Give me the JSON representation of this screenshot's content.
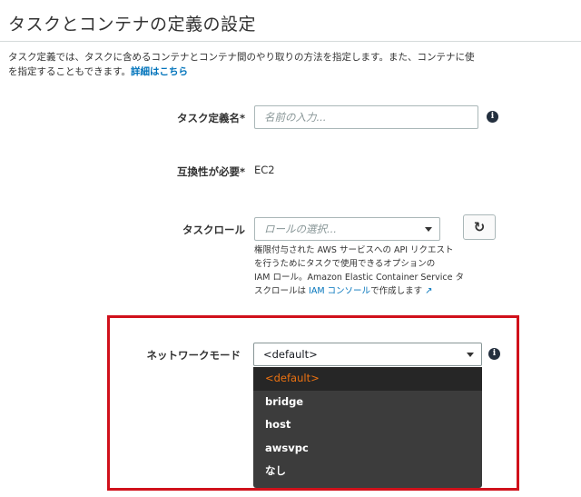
{
  "header": {
    "title": "タスクとコンテナの定義の設定"
  },
  "intro": {
    "line1": "タスク定義では、タスクに含めるコンテナとコンテナ間のやり取りの方法を指定します。また、コンテナに使",
    "line2_prefix": "を指定することもできます。",
    "link": "詳細はこちら"
  },
  "form": {
    "task_name": {
      "label": "タスク定義名",
      "required_mark": "*",
      "placeholder": "名前の入力..."
    },
    "compat": {
      "label": "互換性が必要",
      "required_mark": "*",
      "value": "EC2"
    },
    "task_role": {
      "label": "タスクロール",
      "placeholder": "ロールの選択...",
      "refresh_icon": "refresh-icon",
      "help": {
        "line1": "権限付与された AWS サービスへの API リクエスト",
        "line2": "を行うためにタスクで使用できるオプションの",
        "line3": "IAM ロール。Amazon Elastic Container Service タ",
        "line4_prefix": "スクロールは ",
        "line4_link": "IAM コンソール",
        "line4_suffix": "で作成します"
      }
    },
    "network_mode": {
      "label": "ネットワークモード",
      "value": "<default>",
      "options": [
        "<default>",
        "bridge",
        "host",
        "awsvpc",
        "なし"
      ]
    }
  },
  "info_icon_glyph": "i",
  "colors": {
    "accent": "#ec7211",
    "link": "#0073bb",
    "highlight": "#d0111b",
    "dropdown_bg": "#3c3c3c"
  }
}
